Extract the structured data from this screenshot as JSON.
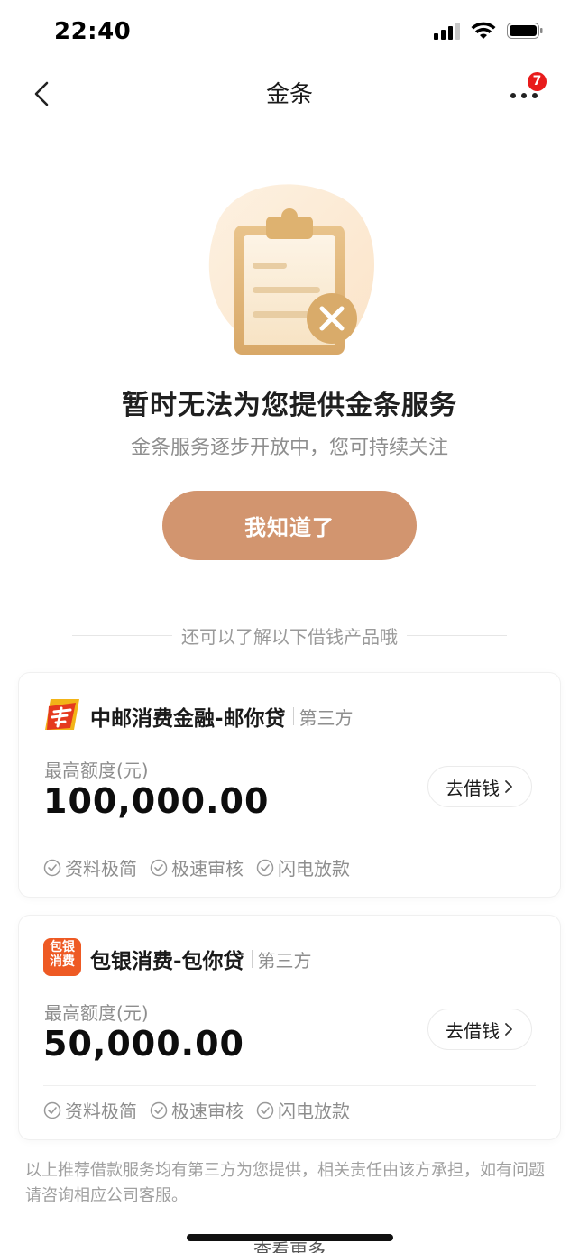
{
  "status_bar": {
    "time": "22:40"
  },
  "nav": {
    "title": "金条",
    "badge_count": "7"
  },
  "hero": {
    "title": "暂时无法为您提供金条服务",
    "subtitle": "金条服务逐步开放中，您可持续关注",
    "button_label": "我知道了"
  },
  "section": {
    "divider_text": "还可以了解以下借钱产品哦"
  },
  "products": [
    {
      "name": "中邮消费金融-邮你贷",
      "tag": "第三方",
      "limit_label": "最高额度(元)",
      "amount": "100,000.00",
      "button_label": "去借钱",
      "features": [
        "资料极简",
        "极速审核",
        "闪电放款"
      ]
    },
    {
      "name": "包银消费-包你贷",
      "tag": "第三方",
      "limit_label": "最高额度(元)",
      "amount": "50,000.00",
      "button_label": "去借钱",
      "features": [
        "资料极简",
        "极速审核",
        "闪电放款"
      ],
      "logo_text": [
        "包银",
        "消费"
      ]
    }
  ],
  "footer": {
    "disclaimer": "以上推荐借款服务均有第三方为您提供，相关责任由该方承担，如有问题请咨询相应公司客服。",
    "see_more": "查看更多"
  },
  "colors": {
    "accent": "#d2956f",
    "badge": "#e81c1c"
  }
}
